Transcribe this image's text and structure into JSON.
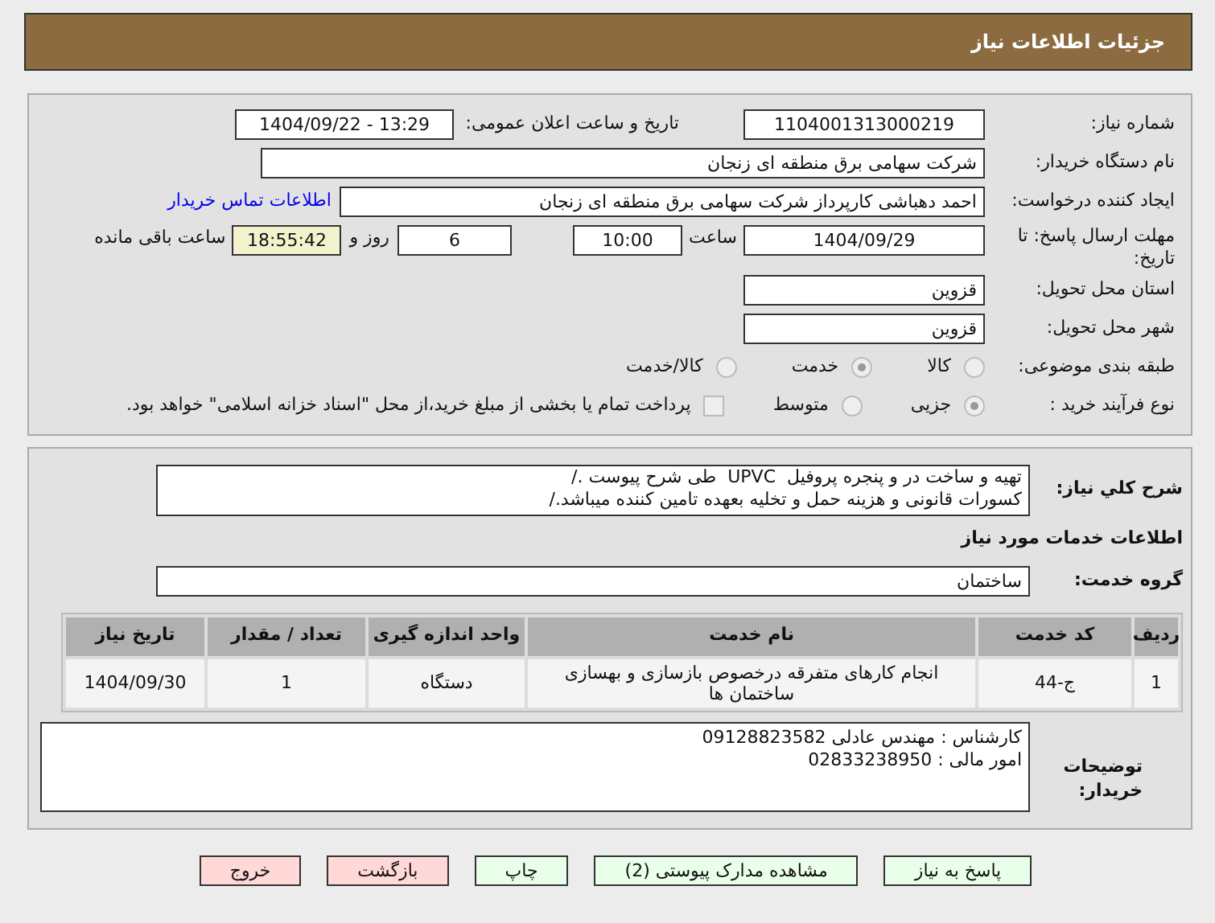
{
  "header": {
    "title": "جزئیات اطلاعات نیاز"
  },
  "need_number": {
    "label": "شماره نیاز:",
    "value": "1104001313000219"
  },
  "announce_datetime": {
    "label": "تاریخ و ساعت اعلان عمومی:",
    "value": "1404/09/22 - 13:29"
  },
  "buyer_org": {
    "label": "نام دستگاه خریدار:",
    "value": "شرکت سهامی برق منطقه ای زنجان"
  },
  "requester": {
    "label": "ایجاد کننده درخواست:",
    "value": "احمد دهباشی کارپرداز شرکت سهامی برق منطقه ای زنجان",
    "link": "اطلاعات تماس خریدار"
  },
  "deadline": {
    "label": "مهلت ارسال پاسخ: تا تاریخ:",
    "date": "1404/09/29",
    "time_label": "ساعت",
    "time": "10:00",
    "days": "6",
    "days_label": "روز و",
    "remaining": "18:55:42",
    "remaining_label": "ساعت باقی مانده"
  },
  "province": {
    "label": "استان محل تحویل:",
    "value": "قزوین"
  },
  "city": {
    "label": "شهر محل تحویل:",
    "value": "قزوین"
  },
  "category": {
    "label": "طبقه بندی موضوعی:",
    "options": [
      {
        "label": "کالا",
        "selected": false
      },
      {
        "label": "خدمت",
        "selected": true
      },
      {
        "label": "کالا/خدمت",
        "selected": false
      }
    ]
  },
  "purchase_type": {
    "label": "نوع فرآیند خرید :",
    "options": [
      {
        "label": "جزیی",
        "selected": true
      },
      {
        "label": "متوسط",
        "selected": false
      }
    ],
    "payment_note": {
      "checked": false,
      "label": "پرداخت تمام یا بخشی از مبلغ خرید،از محل \"اسناد خزانه اسلامی\" خواهد بود."
    }
  },
  "description": {
    "label": "شرح کلي نياز:",
    "lines": [
      "تهیه و ساخت در و پنجره پروفیل  UPVC  طی شرح پیوست ./",
      "کسورات قانونی و هزینه حمل و تخلیه بعهده تامین کننده میباشد./"
    ]
  },
  "services_heading": "اطلاعات خدمات مورد نیاز",
  "service_group": {
    "label": "گروه خدمت:",
    "value": "ساختمان"
  },
  "table": {
    "columns": [
      "ردیف",
      "کد خدمت",
      "نام خدمت",
      "واحد اندازه گیری",
      "تعداد / مقدار",
      "تاریخ نیاز"
    ],
    "rows": [
      [
        "1",
        "ج-44",
        "انجام کارهای متفرقه درخصوص بازسازی و بهسازی ساختمان ها",
        "دستگاه",
        "1",
        "1404/09/30"
      ]
    ]
  },
  "buyer_notes": {
    "label": "توضیحات خریدار:",
    "lines": [
      "کارشناس : مهندس عادلی 09128823582",
      "امور مالی : 02833238950"
    ]
  },
  "buttons": [
    {
      "label": "پاسخ به نیاز",
      "color": "#eaffea"
    },
    {
      "label": "مشاهده مدارک پیوستی (2)",
      "color": "#eaffea"
    },
    {
      "label": "چاپ",
      "color": "#eaffea"
    },
    {
      "label": "بازگشت",
      "color": "#ffd8d8"
    },
    {
      "label": "خروج",
      "color": "#ffd8d8"
    }
  ]
}
